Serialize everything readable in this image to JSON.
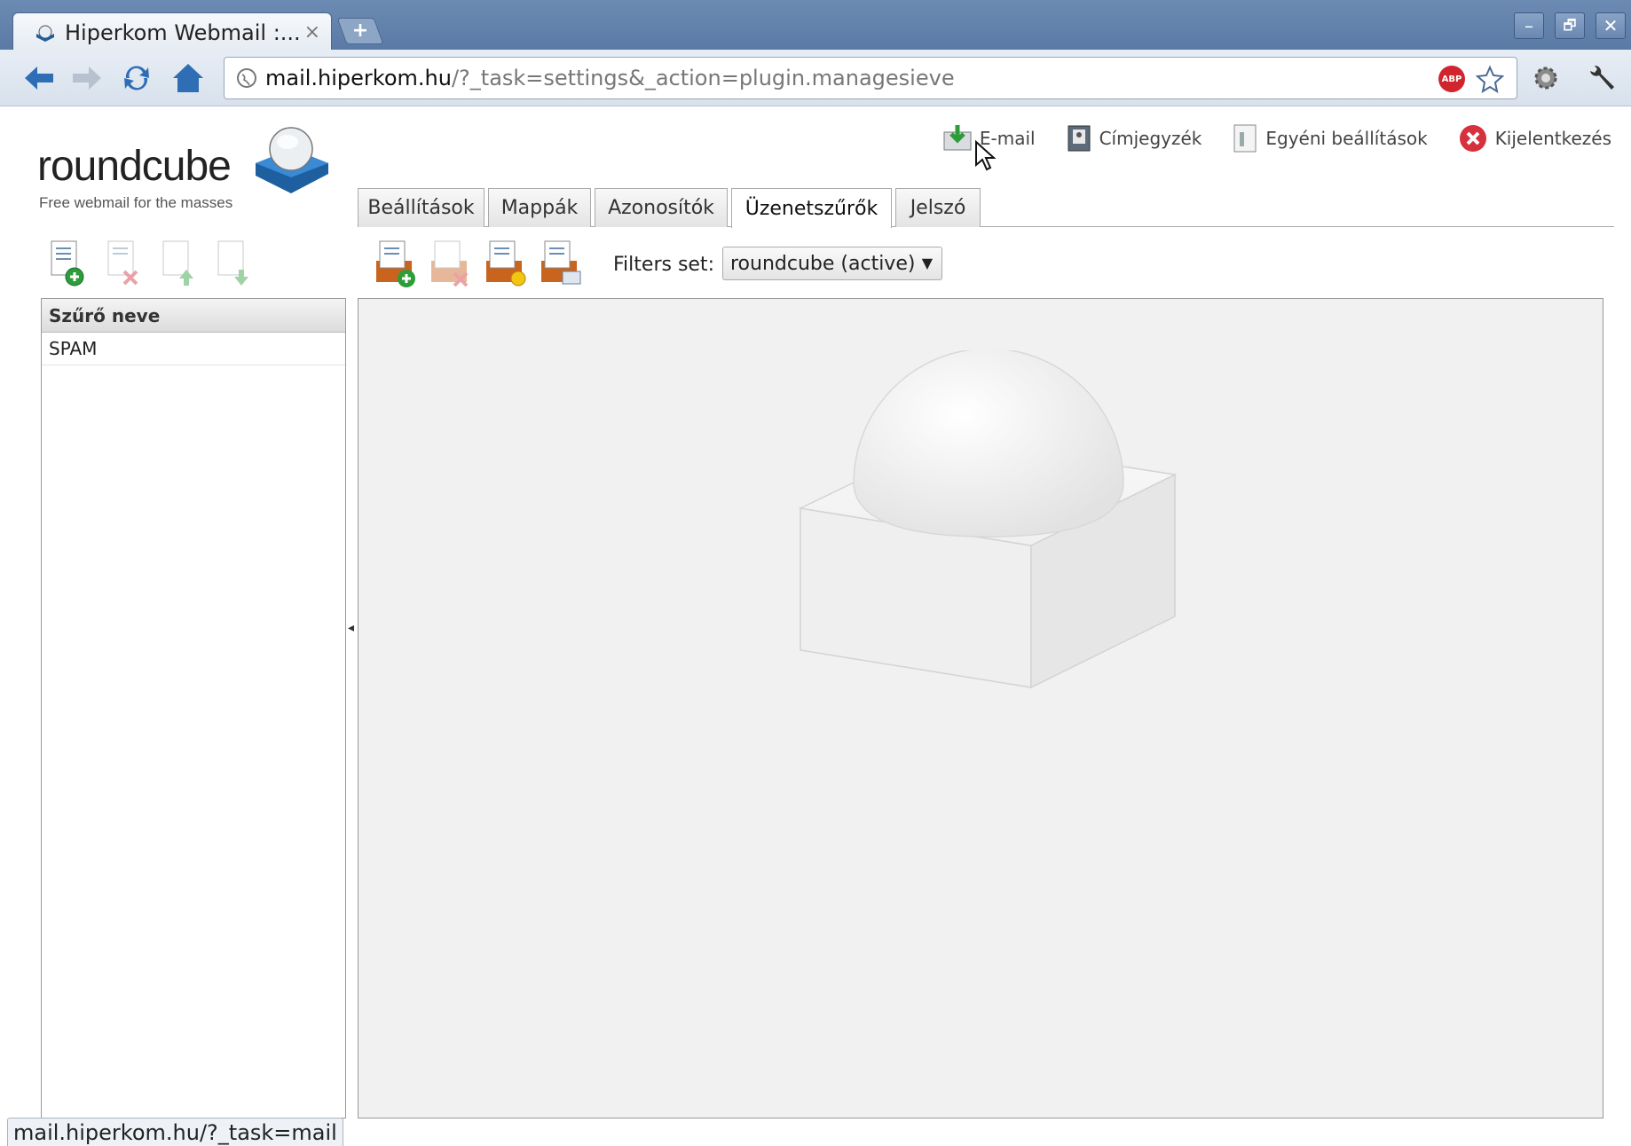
{
  "browser": {
    "tab_title": "Hiperkom Webmail :...",
    "tab_close": "×",
    "new_tab": "+",
    "url_host": "mail.hiperkom.hu",
    "url_path": "/?_task=settings&_action=plugin.managesieve",
    "window_controls": {
      "minimize": "–",
      "restore": "🗗",
      "close": "✕"
    },
    "adblock_label": "ABP",
    "status_text": "mail.hiperkom.hu/?_task=mail"
  },
  "app": {
    "logo_word": "roundcube",
    "logo_tagline": "Free webmail for the masses",
    "topnav": [
      {
        "label": "E-mail",
        "icon": "mail-icon"
      },
      {
        "label": "Címjegyzék",
        "icon": "addressbook-icon"
      },
      {
        "label": "Egyéni beállítások",
        "icon": "settings-icon"
      },
      {
        "label": "Kijelentkezés",
        "icon": "logout-icon"
      }
    ],
    "tabs": [
      "Beállítások",
      "Mappák",
      "Azonosítók",
      "Üzenetszűrők",
      "Jelszó"
    ],
    "selected_tab": "Üzenetszűrők",
    "filters_set_label": "Filters set:",
    "filters_set_value": "roundcube (active)",
    "filter_list_header": "Szűrő neve",
    "filters": [
      "SPAM"
    ]
  },
  "colors": {
    "titlebar": "#5f80ab",
    "accent_blue": "#2f7fd0",
    "logout_red": "#d6313c"
  }
}
